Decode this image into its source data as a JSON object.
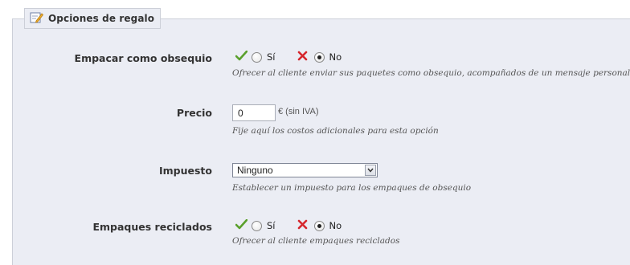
{
  "section": {
    "title": "Opciones de regalo",
    "icon": "edit-note-icon"
  },
  "fields": {
    "gift_wrap": {
      "label": "Empacar como obsequio",
      "yes_label": "Sí",
      "no_label": "No",
      "selected": "No",
      "hint": "Ofrecer al cliente enviar sus paquetes como obsequio, acompañados de un mensaje personal"
    },
    "price": {
      "label": "Precio",
      "value": "0",
      "suffix": "€ (sin IVA)",
      "hint": "Fije aquí los costos adicionales para esta opción"
    },
    "tax": {
      "label": "Impuesto",
      "selected": "Ninguno",
      "hint": "Establecer un impuesto para los empaques de obsequio"
    },
    "recycled": {
      "label": "Empaques reciclados",
      "yes_label": "Sí",
      "no_label": "No",
      "selected": "No",
      "hint": "Ofrecer al cliente empaques reciclados"
    }
  },
  "colors": {
    "yes_icon": "#5aa02c",
    "no_icon": "#d6262c",
    "panel_bg": "#ebedf4"
  }
}
